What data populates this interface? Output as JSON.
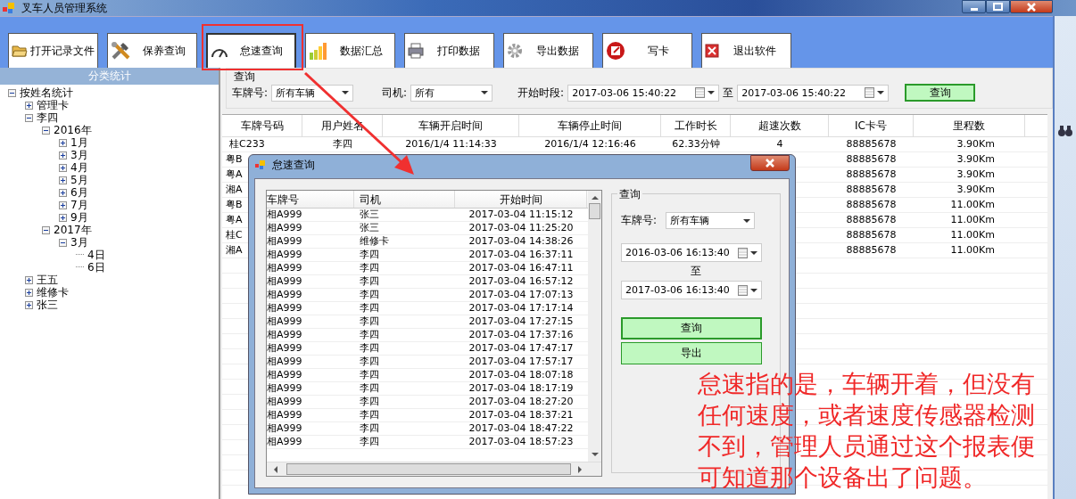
{
  "window": {
    "title": "叉车人员管理系统"
  },
  "toolbar": [
    {
      "label": "打开记录文件",
      "selected": false
    },
    {
      "label": "保养查询",
      "selected": false
    },
    {
      "label": "怠速查询",
      "selected": true
    },
    {
      "label": "数据汇总",
      "selected": false
    },
    {
      "label": "打印数据",
      "selected": false
    },
    {
      "label": "导出数据",
      "selected": false
    },
    {
      "label": "写卡",
      "selected": false
    },
    {
      "label": "退出软件",
      "selected": false
    }
  ],
  "sidebar": {
    "title": "分类统计",
    "tree": [
      {
        "label": "按姓名统计",
        "expanded": true,
        "children": [
          {
            "label": "管理卡",
            "expanded": false
          },
          {
            "label": "李四",
            "expanded": true,
            "children": [
              {
                "label": "2016年",
                "expanded": true,
                "children": [
                  {
                    "label": "1月",
                    "expanded": false
                  },
                  {
                    "label": "3月",
                    "expanded": false
                  },
                  {
                    "label": "4月",
                    "expanded": false
                  },
                  {
                    "label": "5月",
                    "expanded": false
                  },
                  {
                    "label": "6月",
                    "expanded": false
                  },
                  {
                    "label": "7月",
                    "expanded": false
                  },
                  {
                    "label": "9月",
                    "expanded": false
                  }
                ]
              },
              {
                "label": "2017年",
                "expanded": true,
                "children": [
                  {
                    "label": "3月",
                    "expanded": true,
                    "children": [
                      {
                        "label": "4日"
                      },
                      {
                        "label": "6日"
                      }
                    ]
                  }
                ]
              }
            ]
          },
          {
            "label": "王五",
            "expanded": false
          },
          {
            "label": "维修卡",
            "expanded": false
          },
          {
            "label": "张三",
            "expanded": false
          }
        ]
      }
    ]
  },
  "query": {
    "legend": "查询",
    "plate_label": "车牌号:",
    "plate_value": "所有车辆",
    "driver_label": "司机:",
    "driver_value": "所有",
    "period_label": "开始时段:",
    "start": "2017-03-06 15:40:22",
    "to": "至",
    "end": "2017-03-06 15:40:22",
    "button": "查询"
  },
  "table": {
    "columns": [
      "车牌号码",
      "用户姓名",
      "车辆开启时间",
      "车辆停止时间",
      "工作时长",
      "超速次数",
      "IC卡号",
      "里程数"
    ],
    "rows": [
      {
        "cells": [
          "桂C233",
          "李四",
          "2016/1/4 11:14:33",
          "2016/1/4 12:16:46",
          "62.33分钟",
          "4",
          "88885678",
          "3.90Km"
        ]
      },
      {
        "plate": "粤B",
        "ic_card": "88885678",
        "mileage": "3.90Km"
      },
      {
        "plate": "粤A",
        "ic_card": "88885678",
        "mileage": "3.90Km"
      },
      {
        "plate": "湘A",
        "ic_card": "88885678",
        "mileage": "3.90Km"
      },
      {
        "plate": "粤B",
        "ic_card": "88885678",
        "mileage": "11.00Km"
      },
      {
        "plate": "粤A",
        "ic_card": "88885678",
        "mileage": "11.00Km"
      },
      {
        "plate": "桂C",
        "ic_card": "88885678",
        "mileage": "11.00Km"
      },
      {
        "plate": "湘A",
        "ic_card": "88885678",
        "mileage": "11.00Km"
      }
    ]
  },
  "dialog": {
    "title": "怠速查询",
    "list": {
      "columns": [
        "车牌号",
        "司机",
        "开始时间"
      ],
      "rows": [
        [
          "相A999",
          "张三",
          "2017-03-04 11:15:12"
        ],
        [
          "相A999",
          "张三",
          "2017-03-04 11:25:20"
        ],
        [
          "相A999",
          "维修卡",
          "2017-03-04 14:38:26"
        ],
        [
          "相A999",
          "李四",
          "2017-03-04 16:37:11"
        ],
        [
          "相A999",
          "李四",
          "2017-03-04 16:47:11"
        ],
        [
          "相A999",
          "李四",
          "2017-03-04 16:57:12"
        ],
        [
          "相A999",
          "李四",
          "2017-03-04 17:07:13"
        ],
        [
          "相A999",
          "李四",
          "2017-03-04 17:17:14"
        ],
        [
          "相A999",
          "李四",
          "2017-03-04 17:27:15"
        ],
        [
          "相A999",
          "李四",
          "2017-03-04 17:37:16"
        ],
        [
          "相A999",
          "李四",
          "2017-03-04 17:47:17"
        ],
        [
          "相A999",
          "李四",
          "2017-03-04 17:57:17"
        ],
        [
          "相A999",
          "李四",
          "2017-03-04 18:07:18"
        ],
        [
          "相A999",
          "李四",
          "2017-03-04 18:17:19"
        ],
        [
          "相A999",
          "李四",
          "2017-03-04 18:27:20"
        ],
        [
          "相A999",
          "李四",
          "2017-03-04 18:37:21"
        ],
        [
          "相A999",
          "李四",
          "2017-03-04 18:47:22"
        ],
        [
          "相A999",
          "李四",
          "2017-03-04 18:57:23"
        ]
      ]
    },
    "query": {
      "legend": "查询",
      "plate_label": "车牌号:",
      "plate_value": "所有车辆",
      "start": "2016-03-06 16:13:40",
      "to": "至",
      "end": "2017-03-06 16:13:40",
      "buttons": [
        "查询",
        "导出"
      ]
    }
  },
  "annotation": "怠速指的是，车辆开着，但没有任何速度，或者速度传感器检测不到，管理人员通过这个报表便可知道那个设备出了问题。"
}
